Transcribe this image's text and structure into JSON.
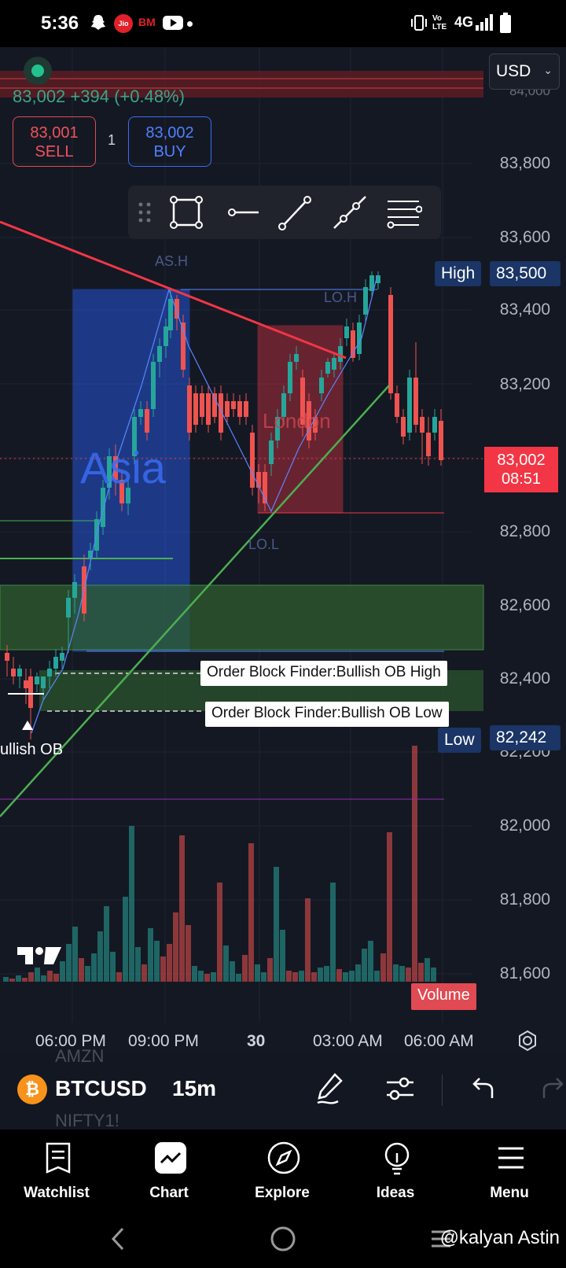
{
  "status_bar": {
    "time": "5:36",
    "carrier_badge": "Jio",
    "bm_badge": "BM",
    "network": "4G"
  },
  "chart": {
    "currency": "USD",
    "quote_line": "83,002  +394 (+0.48%)",
    "sell": {
      "price": "83,001",
      "label": "SELL"
    },
    "quantity": "1",
    "buy": {
      "price": "83,002",
      "label": "BUY"
    },
    "price_axis": [
      "83,800",
      "83,600",
      "83,400",
      "83,200",
      "82,800",
      "82,600",
      "82,400",
      "82,200",
      "82,000",
      "81,800",
      "81,600"
    ],
    "price_axis_top_partial": "84,000",
    "high_tag": {
      "label": "High",
      "value": "83,500"
    },
    "low_tag": {
      "label": "Low",
      "value": "82,242"
    },
    "last_price": {
      "value": "83,002",
      "countdown": "08:51"
    },
    "annotations": {
      "asia": "Asia",
      "london": "London",
      "as_h": "AS.H",
      "lo_h": "LO.H",
      "lo_l": "LO.L",
      "bullish_ob": "ullish OB"
    },
    "ob_high_label": "Order Block Finder:Bullish OB High",
    "ob_low_label": "Order Block Finder:Bullish OB Low",
    "volume_badge": "Volume",
    "time_axis": [
      "06:00 PM",
      "09:00 PM",
      "30",
      "03:00 AM",
      "06:00 AM"
    ],
    "colors": {
      "up": "#26a69a",
      "down": "#ef5350",
      "asia_box": "#2962ff",
      "london_box": "#f23645",
      "ob_zone": "#4caf50"
    }
  },
  "symbol_bar": {
    "ghost_top": "AMZN",
    "symbol": "BTCUSD",
    "interval": "15m",
    "ghost_bottom": "NIFTY1!"
  },
  "bottom_nav": {
    "items": [
      {
        "label": "Watchlist",
        "icon": "watchlist-icon"
      },
      {
        "label": "Chart",
        "icon": "chart-icon"
      },
      {
        "label": "Explore",
        "icon": "compass-icon"
      },
      {
        "label": "Ideas",
        "icon": "lightbulb-icon"
      },
      {
        "label": "Menu",
        "icon": "menu-icon"
      }
    ]
  },
  "watermark": "@kalyan Astin"
}
